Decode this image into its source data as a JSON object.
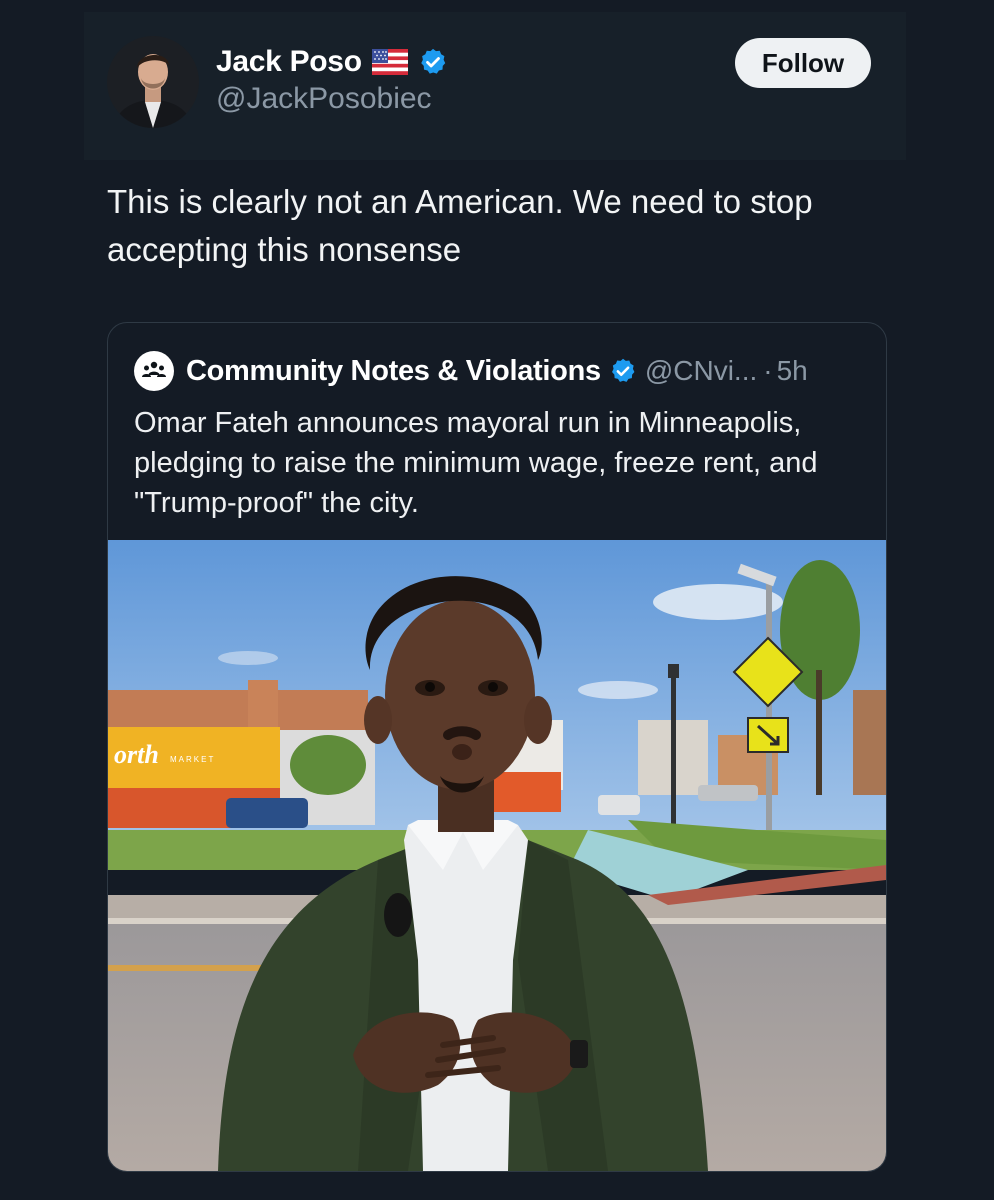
{
  "post": {
    "author": {
      "display_name": "Jack Poso",
      "flag_icon": "us-flag-icon",
      "verified_icon": "verified-badge-icon",
      "handle": "@JackPosobiec"
    },
    "follow_label": "Follow",
    "text": "This is clearly not an American. We need to stop accepting this nonsense"
  },
  "quote": {
    "display_name": "Community Notes & Violations",
    "handle": "@CNvi...",
    "separator": "·",
    "time": "5h",
    "text": "Omar Fateh announces mayoral run in Minneapolis, pledging to raise the minimum wage, freeze rent, and \"Trump-proof\" the city.",
    "media": {
      "store_sign": "orth",
      "store_sign_small": "MARKET"
    }
  },
  "colors": {
    "background": "#141b25",
    "verified_blue": "#1d9bf0",
    "muted_text": "#8b98a5",
    "follow_bg": "#eef1f3"
  }
}
